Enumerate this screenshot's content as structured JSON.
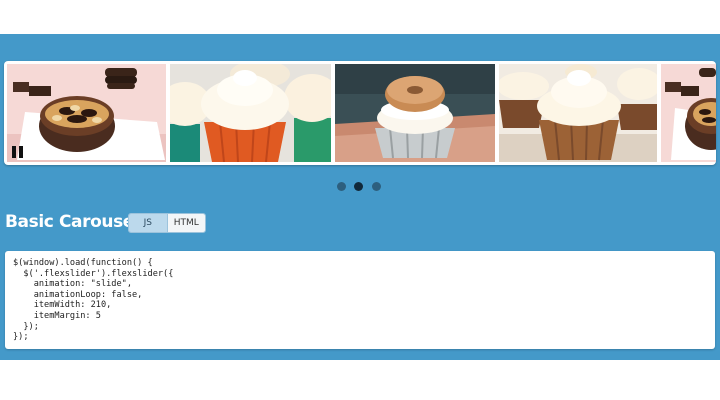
{
  "carousel": {
    "slides": [
      {
        "name": "brownie-donut"
      },
      {
        "name": "frosted-cupcakes"
      },
      {
        "name": "donut-cupcake"
      },
      {
        "name": "cream-cupcakes"
      },
      {
        "name": "brownie-donut-partial"
      }
    ],
    "pause_icon": "pause-icon",
    "pagination_count": 3,
    "active_index": 1
  },
  "section": {
    "title": "Basic Carousel",
    "tabs": [
      {
        "label": "JS",
        "active": true
      },
      {
        "label": "HTML",
        "active": false
      }
    ]
  },
  "code": {
    "lines": [
      "$(window).load(function() {",
      "  $('.flexslider').flexslider({",
      "    animation: \"slide\",",
      "    animationLoop: false,",
      "    itemWidth: 210,",
      "    itemMargin: 5",
      "  });",
      "});"
    ]
  },
  "colors": {
    "band": "#4499c9",
    "dot": "#2d5f7e",
    "dot_active": "#11293a"
  }
}
